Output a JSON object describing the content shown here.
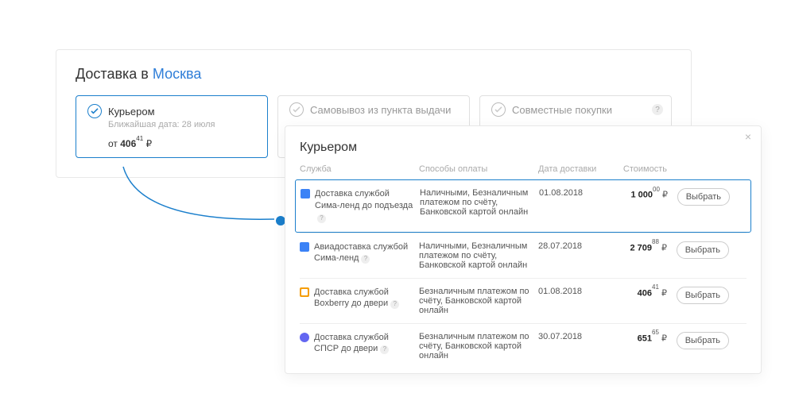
{
  "header": {
    "prefix": "Доставка в",
    "city": "Москва"
  },
  "options": [
    {
      "label": "Курьером",
      "sublabel": "Ближайшая дата: 28 июля",
      "price_prefix": "от",
      "price_int": "406",
      "price_dec": "41",
      "currency": "₽",
      "selected": true
    },
    {
      "label": "Самовывоз из пункта выдачи"
    },
    {
      "label": "Совместные покупки"
    }
  ],
  "modal": {
    "title": "Курьером",
    "columns": {
      "service": "Служба",
      "payment": "Способы оплаты",
      "date": "Дата доставки",
      "cost": "Стоимость"
    },
    "select_label": "Выбрать",
    "currency": "₽",
    "rows": [
      {
        "icon": "blue",
        "service": "Доставка службой Сима-ленд до подъезда",
        "payment": "Наличными, Безналичным платежом по счёту, Банковской картой онлайн",
        "date": "01.08.2018",
        "cost_int": "1 000",
        "cost_dec": "00",
        "selected": true
      },
      {
        "icon": "blue",
        "service": "Авиадоставка службой Сима-ленд",
        "payment": "Наличными, Безналичным платежом по счёту, Банковской картой онлайн",
        "date": "28.07.2018",
        "cost_int": "2 709",
        "cost_dec": "88"
      },
      {
        "icon": "orange",
        "service": "Доставка службой Boxberry до двери",
        "payment": "Безналичным платежом по счёту, Банковской картой онлайн",
        "date": "01.08.2018",
        "cost_int": "406",
        "cost_dec": "41"
      },
      {
        "icon": "purple",
        "service": "Доставка службой СПСР до двери",
        "payment": "Безналичным платежом по счёту, Банковской картой онлайн",
        "date": "30.07.2018",
        "cost_int": "651",
        "cost_dec": "65"
      }
    ]
  }
}
